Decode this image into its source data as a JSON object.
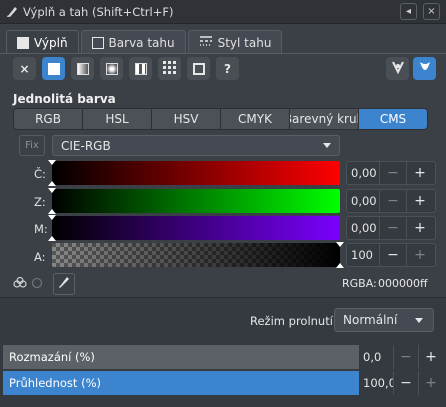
{
  "window": {
    "title": "Výplň a tah (Shift+Ctrl+F)",
    "buttons": [
      "◂",
      "×"
    ]
  },
  "tabs": [
    {
      "label": "Výplň",
      "active": true
    },
    {
      "label": "Barva tahu",
      "active": false
    },
    {
      "label": "Styl tahu",
      "active": false
    }
  ],
  "paint_tools": [
    "×",
    "?"
  ],
  "section": {
    "label": "Jednolitá barva"
  },
  "modes": [
    "RGB",
    "HSL",
    "HSV",
    "CMYK",
    "Barevný kruh",
    "CMS"
  ],
  "active_mode": "CMS",
  "cms": {
    "fix_label": "Fix",
    "profile": "CIE-RGB"
  },
  "sliders": [
    {
      "label": "Č:",
      "value": "0,00",
      "minus": "−",
      "plus": "+",
      "color": "#ff0000"
    },
    {
      "label": "Z:",
      "value": "0,00",
      "minus": "−",
      "plus": "+",
      "color": "#00ff00"
    },
    {
      "label": "M:",
      "value": "0,00",
      "minus": "−",
      "plus": "+",
      "color": "#7b00ff"
    },
    {
      "label": "A:",
      "value": "100",
      "minus": "−",
      "plus": "+"
    }
  ],
  "rgba": {
    "label": "RGBA:",
    "value": "000000ff"
  },
  "blend": {
    "label": "Režim prolnutí:",
    "value": "Normální"
  },
  "blur": {
    "label": "Rozmazání (%)",
    "value": "0,0",
    "minus": "−",
    "plus": "+",
    "level": 0.0
  },
  "opacity": {
    "label": "Průhlednost (%)",
    "value": "100,0",
    "minus": "−",
    "plus": "+",
    "level": 1.0
  },
  "colors": {
    "accent": "#3d84ce",
    "background": "#3b4047"
  }
}
